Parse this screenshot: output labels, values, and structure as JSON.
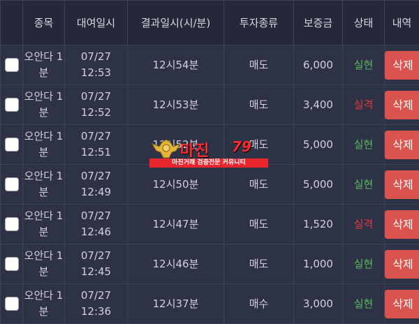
{
  "headers": {
    "check": "",
    "item": "종목",
    "date": "대여일시",
    "result_time": "결과일시(시/분)",
    "type": "투자종류",
    "deposit": "보증금",
    "status": "상태",
    "detail": "내역"
  },
  "rows": [
    {
      "item": "오안다 1분",
      "date": "07/27",
      "time": "12:53",
      "result": "12시54분",
      "type": "매도",
      "deposit": "6,000",
      "status": "실현",
      "status_kind": "win",
      "action": "삭제"
    },
    {
      "item": "오안다 1분",
      "date": "07/27",
      "time": "12:52",
      "result": "12시53분",
      "type": "매도",
      "deposit": "3,400",
      "status": "실격",
      "status_kind": "loss",
      "action": "삭제"
    },
    {
      "item": "오안다 1분",
      "date": "07/27",
      "time": "12:51",
      "result": "12시52분",
      "type": "매도",
      "deposit": "5,000",
      "status": "실현",
      "status_kind": "win",
      "action": "삭제"
    },
    {
      "item": "오안다 1분",
      "date": "07/27",
      "time": "12:49",
      "result": "12시50분",
      "type": "매도",
      "deposit": "5,000",
      "status": "실현",
      "status_kind": "win",
      "action": "삭제"
    },
    {
      "item": "오안다 1분",
      "date": "07/27",
      "time": "12:46",
      "result": "12시47분",
      "type": "매도",
      "deposit": "1,520",
      "status": "실격",
      "status_kind": "loss",
      "action": "삭제"
    },
    {
      "item": "오안다 1분",
      "date": "07/27",
      "time": "12:45",
      "result": "12시46분",
      "type": "매도",
      "deposit": "1,000",
      "status": "실현",
      "status_kind": "win",
      "action": "삭제"
    },
    {
      "item": "오안다 1분",
      "date": "07/27",
      "time": "12:36",
      "result": "12시37분",
      "type": "매수",
      "deposit": "3,000",
      "status": "실현",
      "status_kind": "win",
      "action": "삭제"
    }
  ],
  "watermark": {
    "title": "마진",
    "number": "79",
    "subtitle": "마진거래 검증전문 커뮤니티"
  },
  "colors": {
    "background": "#262a3b",
    "win": "#5cb85c",
    "loss": "#e0393e",
    "button": "#d9534f"
  }
}
